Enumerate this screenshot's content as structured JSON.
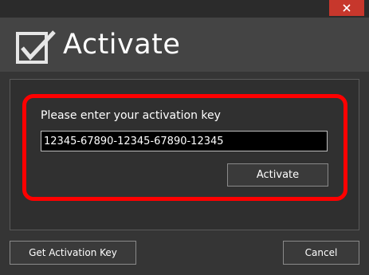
{
  "window": {
    "close_icon": "close-icon",
    "close_color": "#c7372c"
  },
  "header": {
    "icon": "checkmark-icon",
    "title": "Activate"
  },
  "activation": {
    "prompt": "Please enter your activation key",
    "key_value": "12345-67890-12345-67890-12345",
    "activate_label": "Activate",
    "highlight_color": "#ff0000"
  },
  "footer": {
    "get_key_label": "Get Activation Key",
    "cancel_label": "Cancel"
  }
}
